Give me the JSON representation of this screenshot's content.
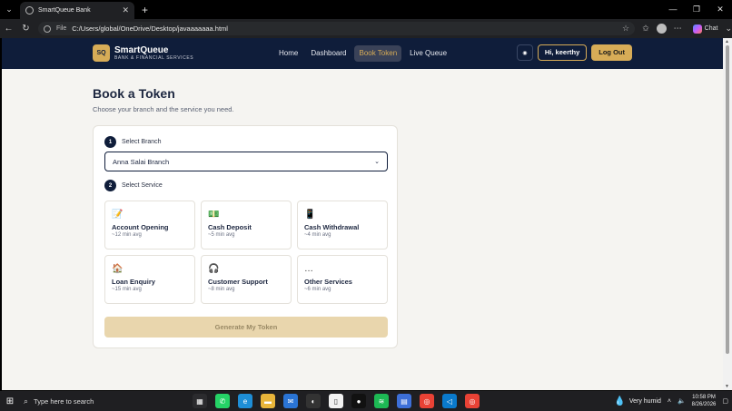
{
  "browser": {
    "tab_title": "SmartQueue Bank",
    "url_scheme": "File",
    "url": "C:/Users/global/OneDrive/Desktop/javaaaaaaa.html",
    "chat_label": "Chat"
  },
  "app": {
    "logo": "SQ",
    "name": "SmartQueue",
    "subtitle": "BANK & FINANCIAL SERVICES",
    "nav": [
      {
        "label": "Home",
        "active": false
      },
      {
        "label": "Dashboard",
        "active": false
      },
      {
        "label": "Book Token",
        "active": true
      },
      {
        "label": "Live Queue",
        "active": false
      }
    ],
    "greeting": "Hi, keerthy",
    "logout_label": "Log Out"
  },
  "page": {
    "title": "Book a Token",
    "subtitle": "Choose your branch and the service you need."
  },
  "form": {
    "step1": {
      "num": "1",
      "label": "Select Branch"
    },
    "branch_value": "Anna Salai Branch",
    "step2": {
      "num": "2",
      "label": "Select Service"
    },
    "services": [
      {
        "icon": "📝",
        "icon_name": "notepad-icon",
        "name": "Account Opening",
        "time": "~12 min avg"
      },
      {
        "icon": "💵",
        "icon_name": "cash-icon",
        "name": "Cash Deposit",
        "time": "~5 min avg"
      },
      {
        "icon": "📱",
        "icon_name": "atm-icon",
        "name": "Cash Withdrawal",
        "time": "~4 min avg"
      },
      {
        "icon": "🏠",
        "icon_name": "house-icon",
        "name": "Loan Enquiry",
        "time": "~15 min avg"
      },
      {
        "icon": "🎧",
        "icon_name": "headphones-icon",
        "name": "Customer Support",
        "time": "~8 min avg"
      },
      {
        "icon": "…",
        "icon_name": "more-icon",
        "name": "Other Services",
        "time": "~6 min avg"
      }
    ],
    "submit_label": "Generate My Token"
  },
  "taskbar": {
    "search_placeholder": "Type here to search",
    "weather": "Very humid",
    "time": "10:58 PM",
    "date": "8/26/2026"
  },
  "colors": {
    "navy": "#0f1d3a",
    "gold": "#d7ac57",
    "gold_disabled": "#e9d6ad",
    "page_bg": "#f5f4f1"
  }
}
